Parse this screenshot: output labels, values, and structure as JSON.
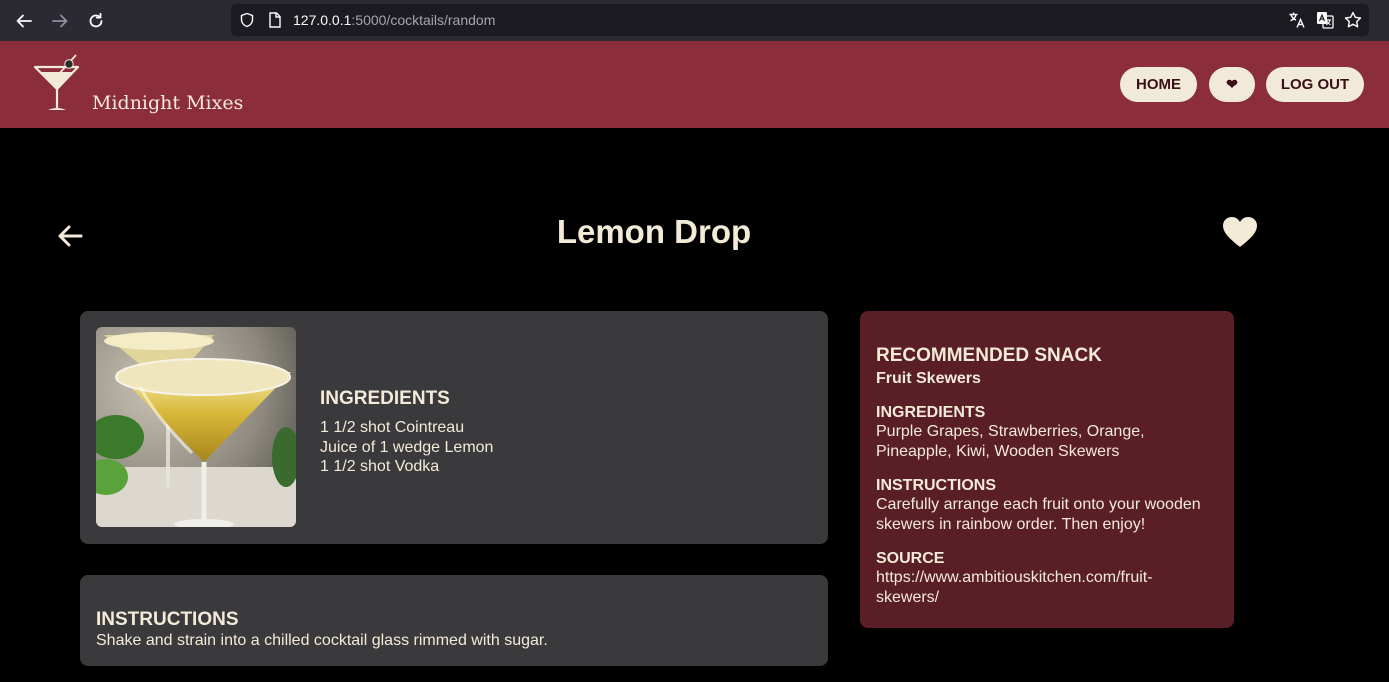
{
  "browser": {
    "url_host": "127.0.0.1",
    "url_path": ":5000/cocktails/random"
  },
  "header": {
    "brand": "Midnight Mixes",
    "nav": {
      "home": "HOME",
      "favorites": "❤",
      "logout": "LOG OUT"
    }
  },
  "cocktail": {
    "name": "Lemon Drop",
    "ingredients_heading": "INGREDIENTS",
    "ingredients": [
      "1 1/2 shot Cointreau",
      "Juice of 1 wedge Lemon",
      "1 1/2 shot Vodka"
    ],
    "instructions_heading": "INSTRUCTIONS",
    "instructions": "Shake and strain into a chilled cocktail glass rimmed with sugar."
  },
  "snack": {
    "heading": "RECOMMENDED SNACK",
    "name": "Fruit Skewers",
    "ingredients_heading": "INGREDIENTS",
    "ingredients": "Purple Grapes, Strawberries, Orange, Pineapple, Kiwi, Wooden Skewers",
    "instructions_heading": "INSTRUCTIONS",
    "instructions": "Carefully arrange each fruit onto your wooden skewers in rainbow order. Then enjoy!",
    "source_heading": "SOURCE",
    "source": "https://www.ambitiouskitchen.com/fruit-skewers/"
  },
  "colors": {
    "header_bg": "#8b2d3a",
    "cream": "#f3ead8",
    "card_bg": "#3a3a3c",
    "snack_bg": "#5a1e26"
  }
}
